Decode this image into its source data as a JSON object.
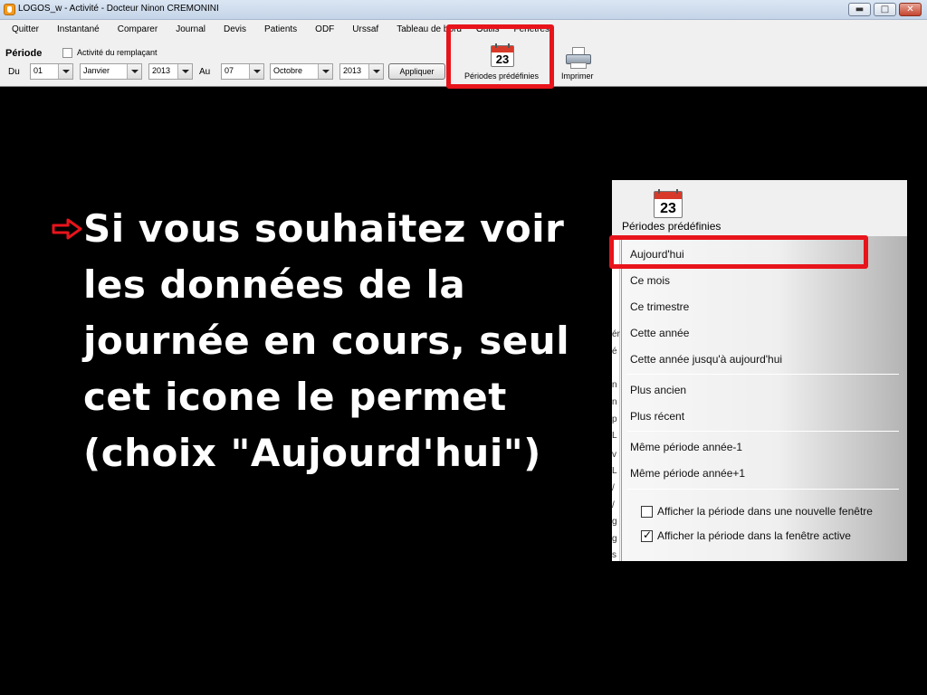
{
  "window": {
    "title": "LOGOS_w - Activité  - Docteur Ninon CREMONINI",
    "buttons": {
      "minimize": "▬",
      "maximize": "□",
      "close": "✕"
    }
  },
  "menu": [
    "Quitter",
    "Instantané",
    "Comparer",
    "Journal",
    "Devis",
    "Patients",
    "ODF",
    "Urssaf",
    "Tableau de bord",
    "Outils",
    "Fenêtres"
  ],
  "toolbar": {
    "periode_label": "Période",
    "remplacant_label": "Activité du remplaçant",
    "du_label": "Du",
    "au_label": "Au",
    "from_day": "01",
    "from_month": "Janvier",
    "from_year": "2013",
    "to_day": "07",
    "to_month": "Octobre",
    "to_year": "2013",
    "apply_label": "Appliquer",
    "periodes_label": "Périodes prédéfinies",
    "imprimer_label": "Imprimer",
    "calendar_number": "23"
  },
  "slide": {
    "text": "Si vous souhaitez voir les données de la journée en cours, seul cet icone le permet (choix \"Aujourd'hui\")"
  },
  "dropdown": {
    "header_label": "Périodes prédéfinies",
    "calendar_number": "23",
    "left_fragments": [
      "ér",
      "é",
      "n",
      "n",
      "p",
      "L",
      "v",
      "L",
      "/",
      "/",
      "g",
      "g",
      "s"
    ],
    "group1": [
      "Aujourd'hui",
      "Ce mois",
      "Ce trimestre",
      "Cette année",
      "Cette année jusqu'à aujourd'hui"
    ],
    "group2": [
      "Plus ancien",
      "Plus récent"
    ],
    "group3": [
      "Même période année-1",
      "Même période année+1"
    ],
    "checkboxes": [
      {
        "label": "Afficher la période dans une nouvelle fenêtre",
        "checked": false
      },
      {
        "label": "Afficher la période dans la fenêtre active",
        "checked": true
      }
    ]
  },
  "colors": {
    "highlight": "#e8141b",
    "background": "#000000",
    "text": "#ffffff"
  }
}
